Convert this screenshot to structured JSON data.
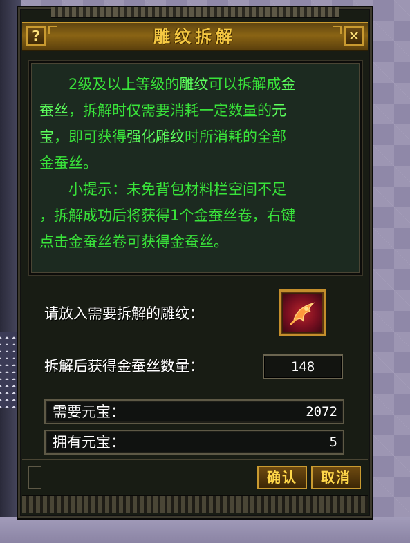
{
  "dialog": {
    "title": "雕纹拆解",
    "help_glyph": "?",
    "close_glyph": "✕"
  },
  "info": {
    "line1_a": "2级及以上等级的",
    "line1_b": "雕纹",
    "line1_c": "可以拆解成",
    "line1_d": "金",
    "line2_a": "蚕丝",
    "line2_b": "，拆解时仅需要消耗一定数量的",
    "line2_c": "元",
    "line3_a": "宝",
    "line3_b": "，即可获得",
    "line3_c": "强化雕纹",
    "line3_d": "时所消耗的全部",
    "line4": "金蚕丝。",
    "line5": "小提示：未免背包材料栏空间不足",
    "line6": "，拆解成功后将获得1个金蚕丝卷，右键",
    "line7": "点击金蚕丝卷可获得金蚕丝。"
  },
  "slot": {
    "label": "请放入需要拆解的雕纹：",
    "item_icon": "carving-item-icon"
  },
  "yield": {
    "label": "拆解后获得金蚕丝数量：",
    "value": "148"
  },
  "cost": {
    "required_label": "需要元宝：",
    "required_value": "2072",
    "owned_label": "拥有元宝：",
    "owned_value": "5"
  },
  "buttons": {
    "confirm": "确认",
    "cancel": "取消"
  },
  "colors": {
    "info_text": "#39e33a",
    "title": "#f5c842",
    "frame_gold": "#c99a30"
  }
}
